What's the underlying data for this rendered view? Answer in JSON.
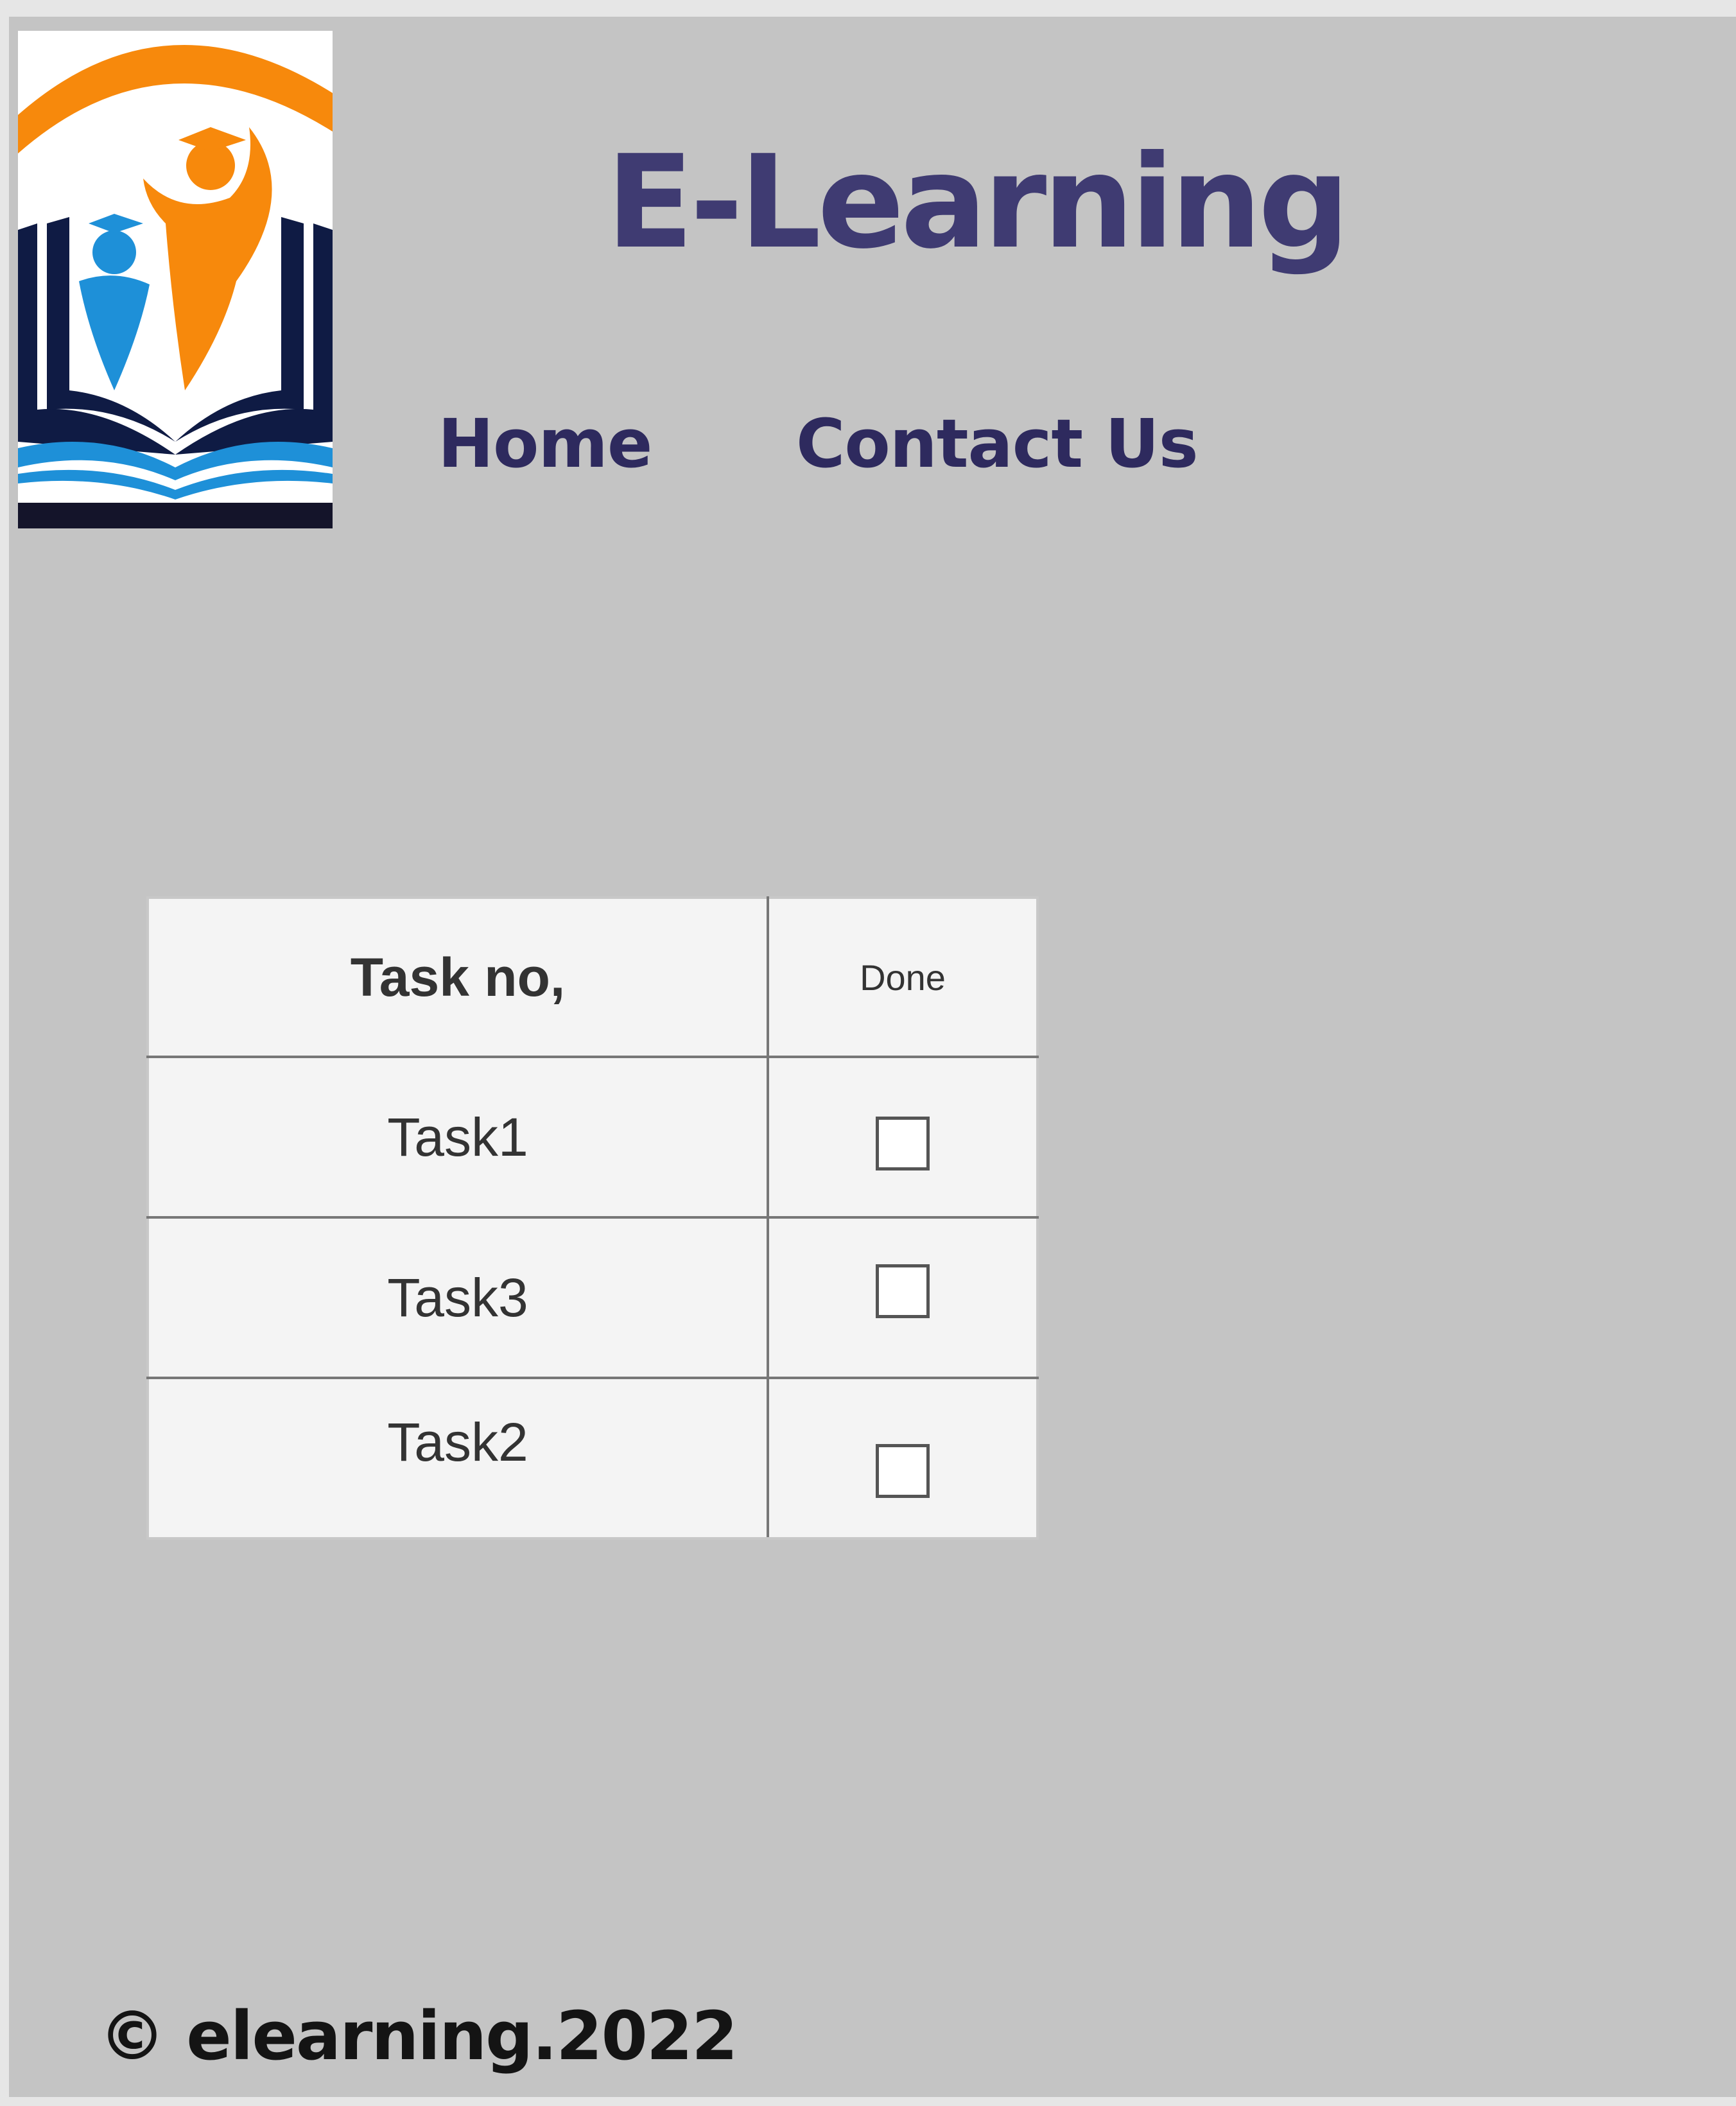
{
  "header": {
    "logo_name": "e-learning-logo",
    "title": "E-Learning"
  },
  "nav": {
    "items": [
      {
        "label": "Home"
      },
      {
        "label": "Contact Us"
      }
    ]
  },
  "table": {
    "headers": [
      "Task no,",
      "Done"
    ],
    "rows": [
      {
        "task": "Task1",
        "done": false
      },
      {
        "task": "Task3",
        "done": false
      },
      {
        "task": "Task2",
        "done": false
      }
    ]
  },
  "footer": {
    "text": "© elearning.2022"
  },
  "colors": {
    "background": "#c4c4c4",
    "title": "#3f3b72",
    "nav": "#2e2a5e",
    "table_bg": "#f4f4f4",
    "logo_orange": "#f7890c",
    "logo_blue": "#1e90d8",
    "logo_navy": "#0f1b44"
  }
}
